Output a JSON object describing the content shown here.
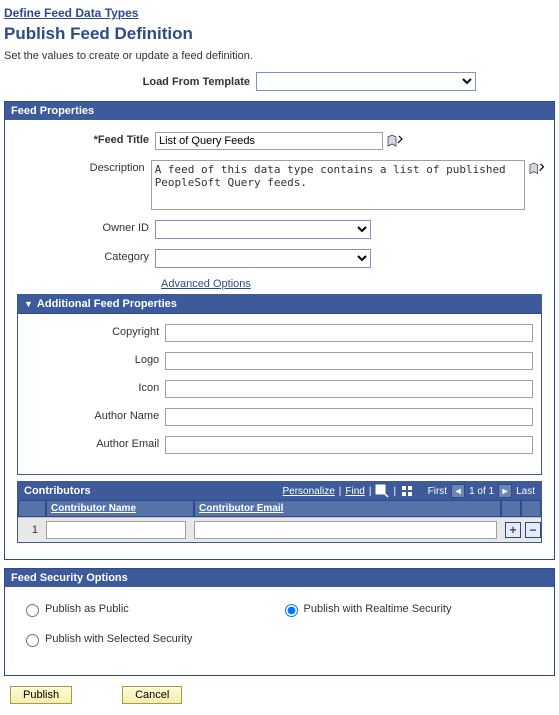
{
  "breadcrumb": "Define Feed Data Types",
  "page_title": "Publish Feed Definition",
  "subtitle": "Set the values to create or update a feed definition.",
  "template": {
    "label": "Load From Template",
    "value": ""
  },
  "feed_properties": {
    "header": "Feed Properties",
    "feed_title": {
      "label": "Feed Title",
      "value": "List of Query Feeds"
    },
    "description": {
      "label": "Description",
      "value": "A feed of this data type contains a list of published PeopleSoft Query feeds."
    },
    "owner_id": {
      "label": "Owner ID",
      "value": ""
    },
    "category": {
      "label": "Category",
      "value": ""
    },
    "advanced_link": "Advanced Options"
  },
  "additional": {
    "header": "Additional Feed Properties",
    "copyright": {
      "label": "Copyright",
      "value": ""
    },
    "logo": {
      "label": "Logo",
      "value": ""
    },
    "icon": {
      "label": "Icon",
      "value": ""
    },
    "author_name": {
      "label": "Author Name",
      "value": ""
    },
    "author_email": {
      "label": "Author Email",
      "value": ""
    }
  },
  "contributors": {
    "header": "Contributors",
    "tools": {
      "personalize": "Personalize",
      "find": "Find",
      "first": "First",
      "range": "1 of 1",
      "last": "Last"
    },
    "columns": {
      "name": "Contributor Name",
      "email": "Contributor Email"
    },
    "rows": [
      {
        "num": "1",
        "name": "",
        "email": ""
      }
    ]
  },
  "security": {
    "header": "Feed Security Options",
    "options": {
      "public": "Publish as Public",
      "realtime": "Publish with Realtime Security",
      "selected": "Publish with Selected Security"
    },
    "selected_value": "realtime"
  },
  "buttons": {
    "publish": "Publish",
    "cancel": "Cancel"
  }
}
